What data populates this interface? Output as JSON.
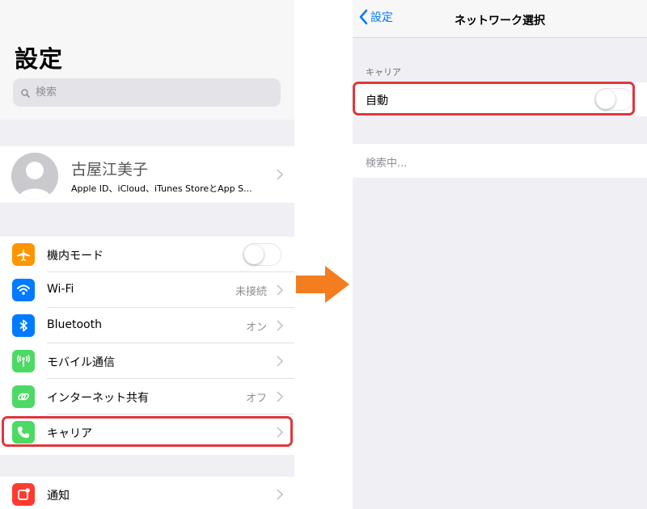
{
  "settings": {
    "title": "設定",
    "search_placeholder": "検索",
    "profile": {
      "name": "古屋江美子",
      "subtitle": "Apple ID、iCloud、iTunes StoreとApp S..."
    },
    "items": [
      {
        "label": "機内モード",
        "icon": "airplane-icon",
        "color": "#ff9500",
        "value": "",
        "toggle": true,
        "toggle_on": false
      },
      {
        "label": "Wi-Fi",
        "icon": "wifi-icon",
        "color": "#007aff",
        "value": "未接続",
        "toggle": false
      },
      {
        "label": "Bluetooth",
        "icon": "bluetooth-icon",
        "color": "#007aff",
        "value": "オン",
        "toggle": false
      },
      {
        "label": "モバイル通信",
        "icon": "cellular-icon",
        "color": "#4cd964",
        "value": "",
        "toggle": false
      },
      {
        "label": "インターネット共有",
        "icon": "hotspot-icon",
        "color": "#4cd964",
        "value": "オフ",
        "toggle": false
      },
      {
        "label": "キャリア",
        "icon": "phone-icon",
        "color": "#4cd964",
        "value": "",
        "toggle": false,
        "highlighted": true
      }
    ],
    "notifications": {
      "label": "通知",
      "icon": "notifications-icon",
      "color": "#ff3b30"
    }
  },
  "network": {
    "back_label": "設定",
    "title": "ネットワーク選択",
    "section_header": "キャリア",
    "auto_label": "自動",
    "auto_toggle_on": false,
    "searching_label": "検索中..."
  },
  "colors": {
    "highlight": "#e0363c",
    "arrow": "#f47d20",
    "ios_blue": "#007aff"
  }
}
